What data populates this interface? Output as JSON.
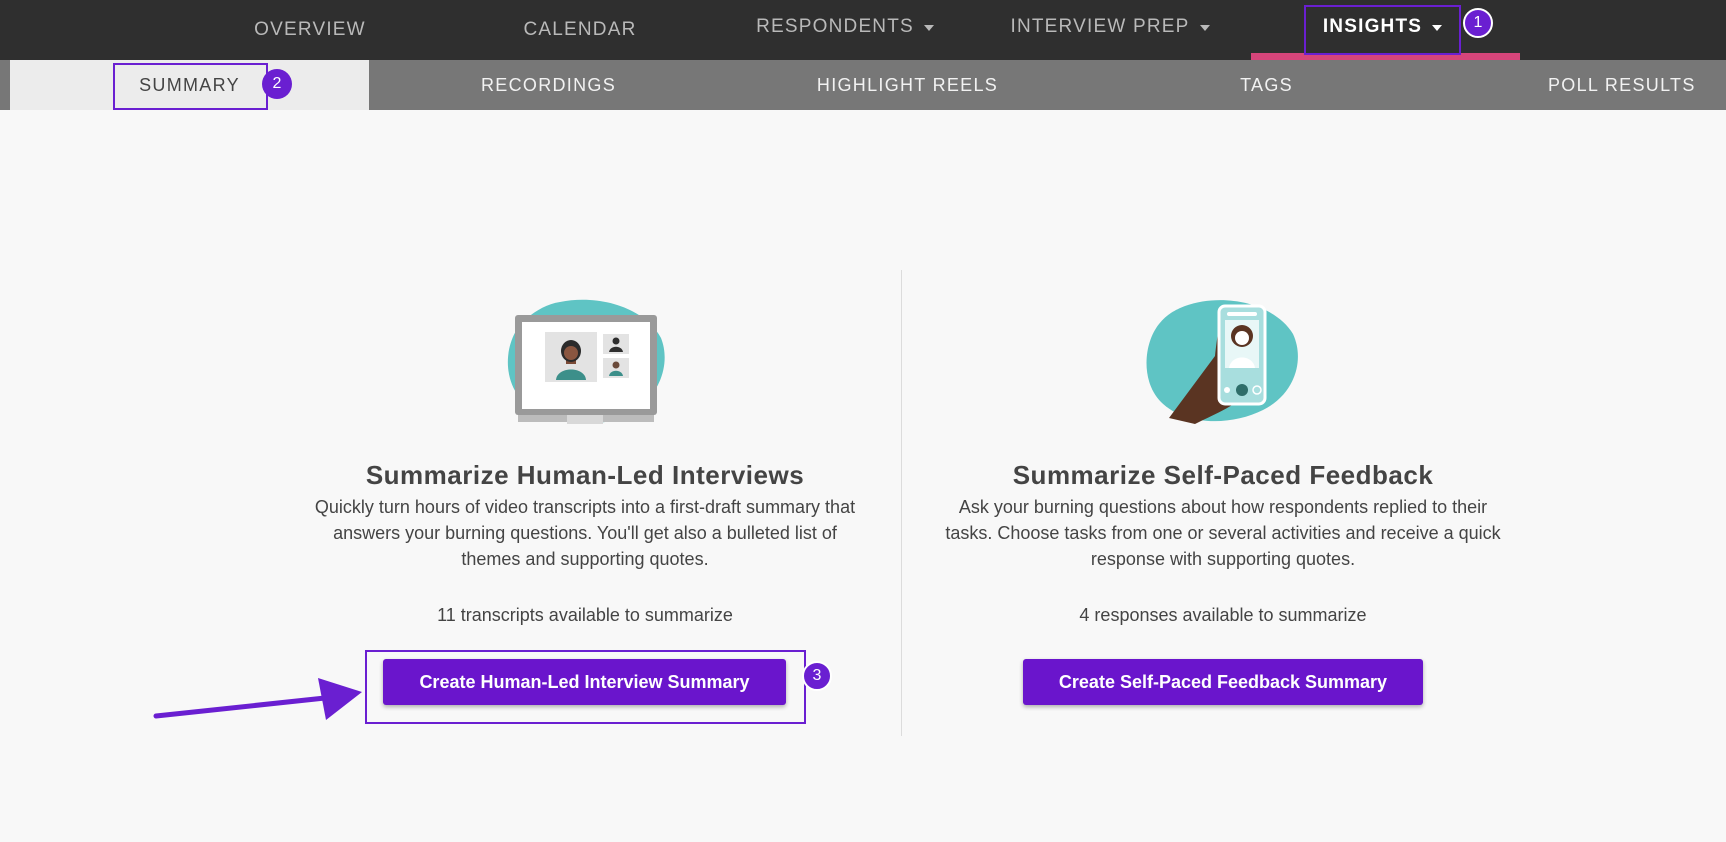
{
  "topnav": {
    "items": [
      {
        "label": "OVERVIEW"
      },
      {
        "label": "CALENDAR"
      },
      {
        "label": "RESPONDENTS"
      },
      {
        "label": "INTERVIEW PREP"
      },
      {
        "label": "INSIGHTS"
      }
    ]
  },
  "subnav": {
    "items": [
      {
        "label": "SUMMARY"
      },
      {
        "label": "RECORDINGS"
      },
      {
        "label": "HIGHLIGHT REELS"
      },
      {
        "label": "TAGS"
      },
      {
        "label": "POLL RESULTS"
      }
    ]
  },
  "annotations": {
    "badge1": "1",
    "badge2": "2",
    "badge3": "3"
  },
  "human_led": {
    "title": "Summarize Human-Led Interviews",
    "description": "Quickly turn hours of video transcripts into a first-draft summary that answers your burning questions. You'll get also a bulleted list of themes and supporting quotes.",
    "count_text": "11 transcripts available to summarize",
    "button_label": "Create Human-Led Interview Summary"
  },
  "self_paced": {
    "title": "Summarize Self-Paced Feedback",
    "description": "Ask your burning questions about how respondents replied to their tasks. Choose tasks from one or several activities and receive a quick response with supporting quotes.",
    "count_text": "4 responses available to summarize",
    "button_label": "Create Self-Paced Feedback Summary"
  },
  "colors": {
    "accent": "#6a15cc",
    "annotation": "#6a1fd1",
    "active_underline": "#d6457a",
    "illustration_teal": "#5fc4c4"
  },
  "icons": [
    "chevron-down-icon",
    "video-conference-illustration",
    "phone-in-hand-illustration",
    "annotation-arrow"
  ]
}
